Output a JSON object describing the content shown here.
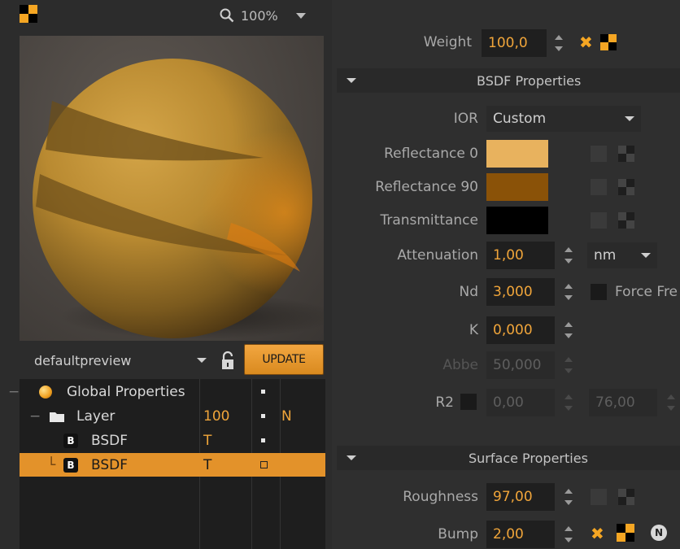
{
  "preview": {
    "zoom": "100%",
    "preset": "defaultpreview",
    "update_label": "UPDATE"
  },
  "tree": {
    "rows": [
      {
        "name": "Global Properties",
        "value": "",
        "flag": "",
        "icon": "sphere-icon",
        "selected": false
      },
      {
        "name": "Layer",
        "value": "100",
        "flag": "N",
        "icon": "folder-icon",
        "selected": false
      },
      {
        "name": "BSDF",
        "value": "T",
        "flag": "",
        "icon": "B",
        "selected": false
      },
      {
        "name": "BSDF",
        "value": "T",
        "flag": "",
        "icon": "B",
        "selected": true
      }
    ]
  },
  "weight": {
    "label": "Weight",
    "value": "100,0"
  },
  "bsdf_section": {
    "title": "BSDF Properties",
    "ior_label": "IOR",
    "ior_value": "Custom",
    "reflectance0_label": "Reflectance 0",
    "reflectance0_color": "#e8b25e",
    "reflectance90_label": "Reflectance 90",
    "reflectance90_color": "#8a5208",
    "transmittance_label": "Transmittance",
    "transmittance_color": "#000000",
    "attenuation_label": "Attenuation",
    "attenuation_value": "1,00",
    "attenuation_unit": "nm",
    "nd_label": "Nd",
    "nd_value": "3,000",
    "force_label": "Force Fre",
    "k_label": "K",
    "k_value": "0,000",
    "abbe_label": "Abbe",
    "abbe_value": "50,000",
    "r2_label": "R2",
    "r2_value1": "0,00",
    "r2_value2": "76,00"
  },
  "surface_section": {
    "title": "Surface Properties",
    "roughness_label": "Roughness",
    "roughness_value": "97,00",
    "bump_label": "Bump",
    "bump_value": "2,00"
  },
  "colors": {
    "accent": "#f0a53a",
    "selection": "#e3922a"
  }
}
